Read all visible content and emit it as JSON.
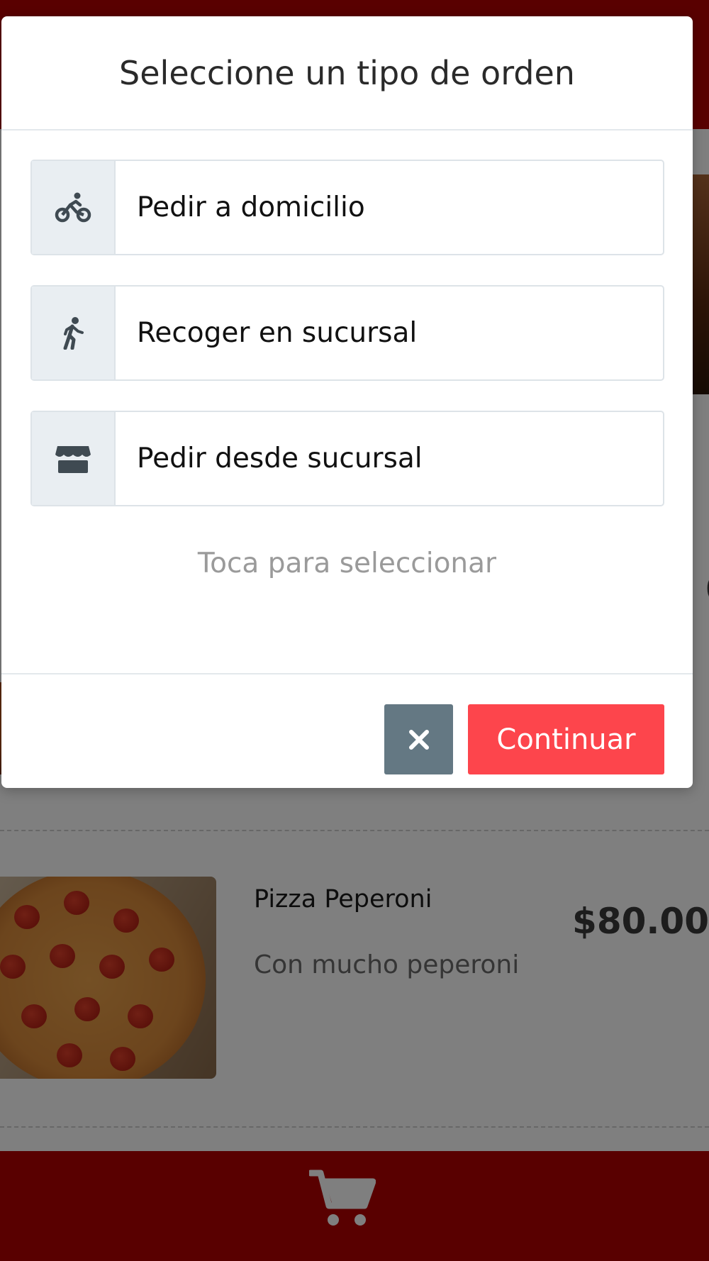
{
  "modal": {
    "title": "Seleccione un tipo de orden",
    "options": [
      {
        "label": "Pedir a domicilio",
        "icon": "bicycle-icon"
      },
      {
        "label": "Recoger en sucursal",
        "icon": "walking-icon"
      },
      {
        "label": "Pedir desde sucursal",
        "icon": "store-icon"
      }
    ],
    "hint": "Toca para seleccionar",
    "close_icon": "close-icon",
    "continue_label": "Continuar"
  },
  "background": {
    "products": [
      {
        "name": "",
        "description": "",
        "price": "0"
      },
      {
        "name": "Pizza Peperoni",
        "description": "Con mucho peperoni",
        "price": "$80.00"
      }
    ],
    "footer_icon": "cart-icon"
  },
  "colors": {
    "header_red": "#b30000",
    "continue_red": "#fd454c",
    "close_gray": "#647883",
    "icon_box": "#e9eef2"
  }
}
